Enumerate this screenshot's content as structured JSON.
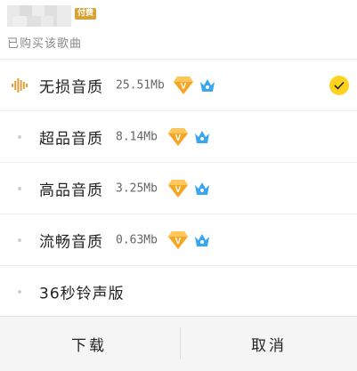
{
  "header": {
    "badge": "付费",
    "subtitle": "已购买该歌曲"
  },
  "qualities": [
    {
      "name": "无损音质",
      "size": "25.51Mb",
      "selected": true,
      "lead_icon": "sound-wave-icon"
    },
    {
      "name": "超品音质",
      "size": "8.14Mb",
      "selected": false,
      "lead_icon": "bullet-dot"
    },
    {
      "name": "高品音质",
      "size": "3.25Mb",
      "selected": false,
      "lead_icon": "bullet-dot"
    },
    {
      "name": "流畅音质",
      "size": "0.63Mb",
      "selected": false,
      "lead_icon": "bullet-dot"
    },
    {
      "name": "36秒铃声版",
      "size": "",
      "selected": false,
      "lead_icon": "bullet-dot"
    }
  ],
  "badges": {
    "vip_icon": "vip-diamond-icon",
    "crown_icon": "blue-crown-icon"
  },
  "footer": {
    "download_label": "下载",
    "cancel_label": "取消"
  },
  "colors": {
    "accent_yellow": "#ffd21f",
    "vip_orange": "#f5a623",
    "crown_blue": "#3aa6f0",
    "wave_gold": "#e0a23c"
  }
}
